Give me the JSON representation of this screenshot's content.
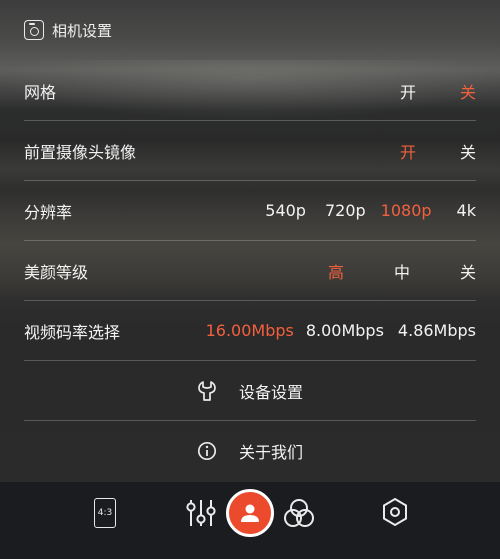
{
  "header": {
    "title": "相机设置",
    "icon": "camera-icon"
  },
  "rows": [
    {
      "label": "网格",
      "options": [
        "开",
        "关"
      ],
      "active": "关"
    },
    {
      "label": "前置摄像头镜像",
      "options": [
        "开",
        "关"
      ],
      "active": "开"
    },
    {
      "label": "分辨率",
      "options": [
        "540p",
        "720p",
        "1080p",
        "4k"
      ],
      "active": "1080p"
    },
    {
      "label": "美颜等级",
      "options": [
        "高",
        "中",
        "关"
      ],
      "active": "高"
    },
    {
      "label": "视频码率选择",
      "options": [
        "16.00Mbps",
        "8.00Mbps",
        "4.86Mbps"
      ],
      "active": "16.00Mbps"
    }
  ],
  "links": [
    {
      "label": "设备设置",
      "icon": "wrench-icon"
    },
    {
      "label": "关于我们",
      "icon": "info-icon"
    }
  ],
  "bottom_bar": {
    "aspect_ratio": "4:3",
    "items": [
      "aspect-ratio-icon",
      "sliders-icon",
      "shutter-button",
      "filters-icon",
      "settings-hexagon-icon"
    ]
  },
  "colors": {
    "accent": "#f2603e",
    "shutter": "#eb4b2c",
    "bar": "#1b1c20"
  }
}
